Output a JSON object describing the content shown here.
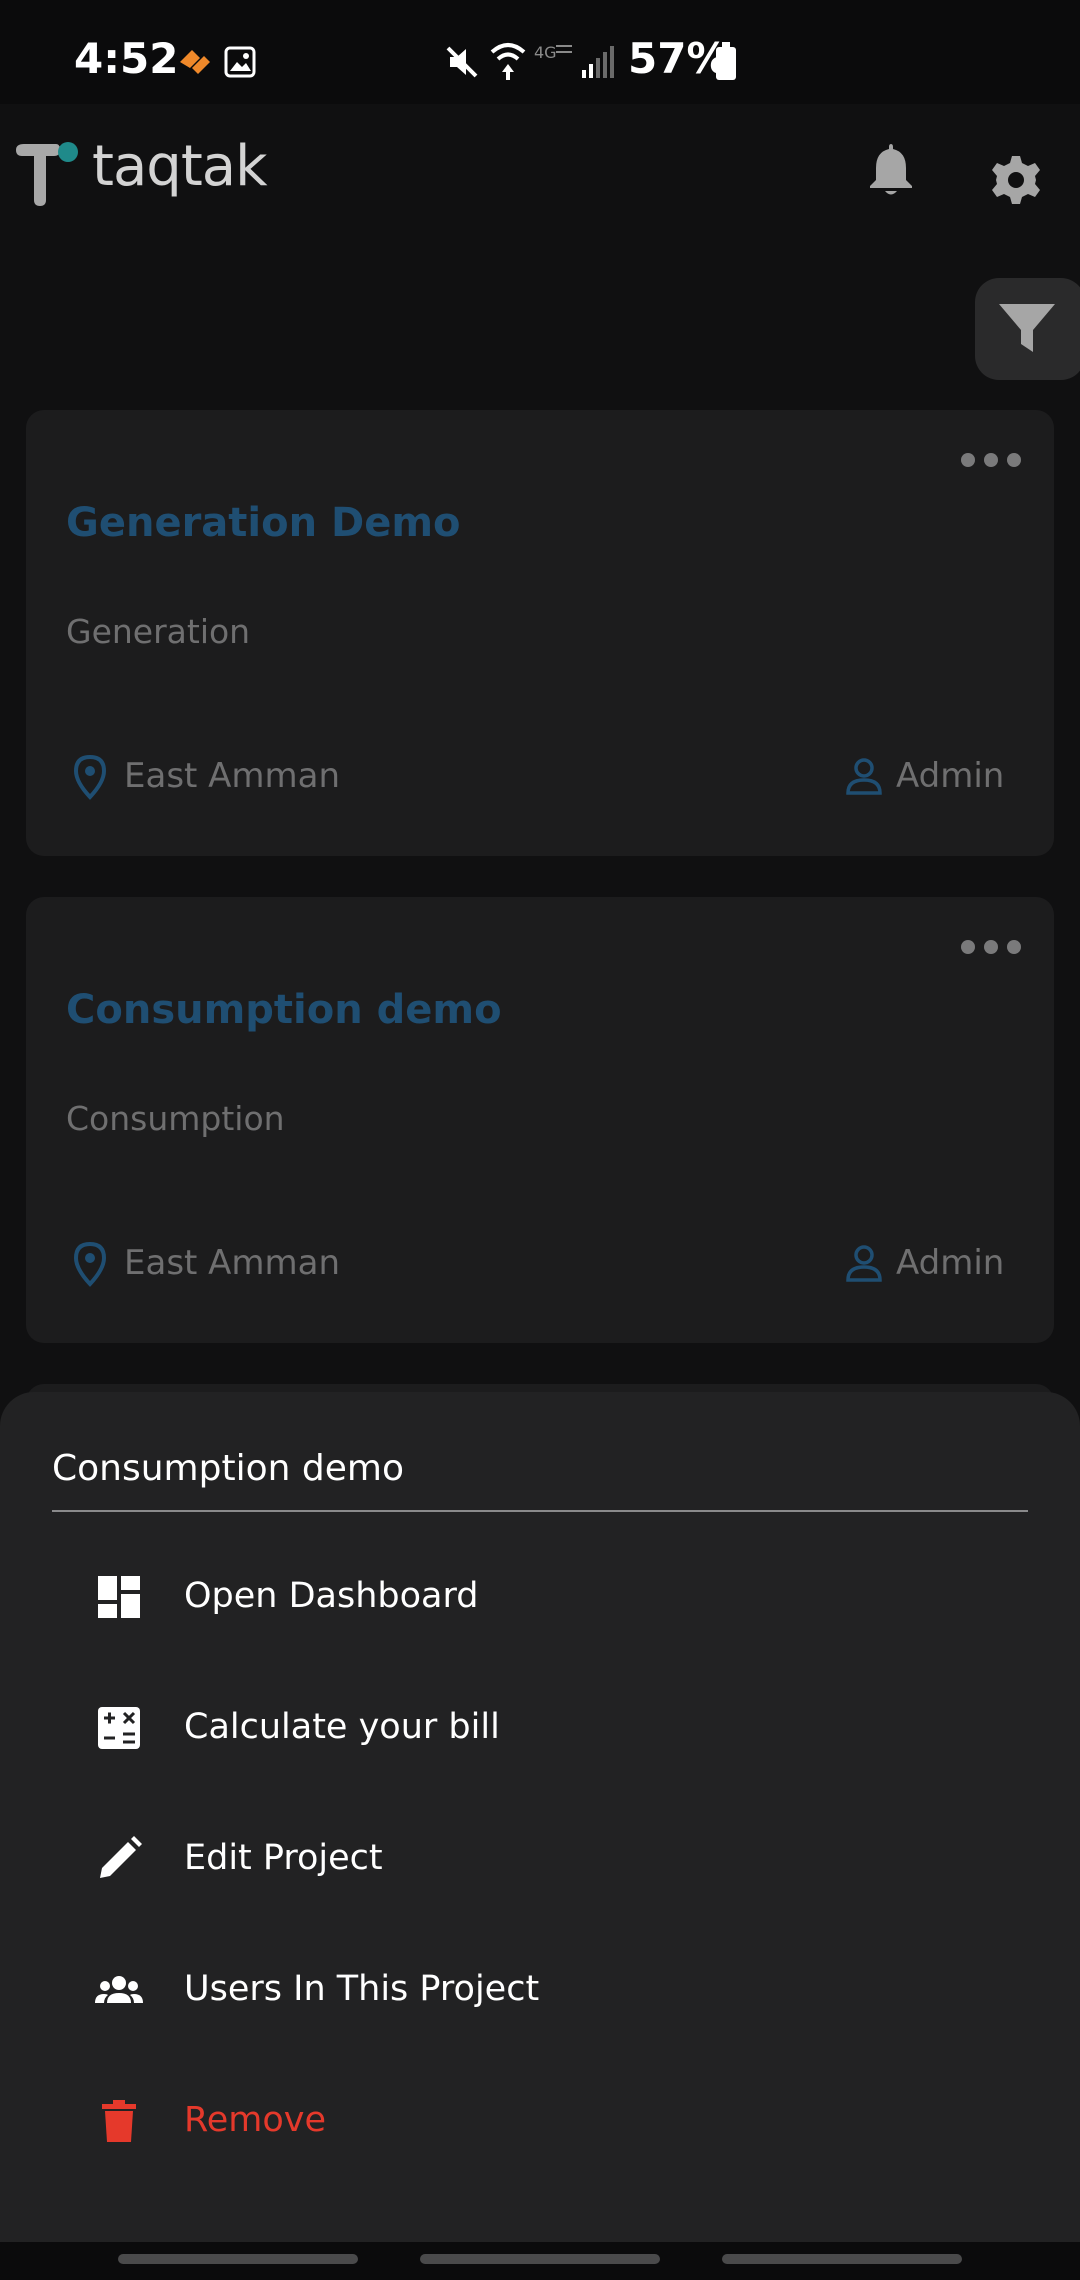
{
  "status_bar": {
    "time": "4:52",
    "battery": "57%",
    "icons": [
      "app-badge-icon",
      "gallery-icon",
      "mute-icon",
      "wifi-icon",
      "lte-icon",
      "signal-icon",
      "battery-icon"
    ]
  },
  "app_bar": {
    "logo_text": "taqtak",
    "icons": [
      "bell-icon",
      "gear-icon"
    ]
  },
  "filter": {
    "icon": "filter-icon"
  },
  "projects": [
    {
      "name": "Generation Demo",
      "type": "Generation",
      "location": "East Amman",
      "role": "Admin"
    },
    {
      "name": "Consumption demo",
      "type": "Consumption",
      "location": "East Amman",
      "role": "Admin"
    }
  ],
  "sheet": {
    "title": "Consumption demo",
    "items": [
      {
        "label": "Open Dashboard",
        "icon": "dashboard-icon"
      },
      {
        "label": "Calculate your bill",
        "icon": "calculator-icon"
      },
      {
        "label": "Edit Project",
        "icon": "pencil-icon"
      },
      {
        "label": "Users In This Project",
        "icon": "users-icon"
      },
      {
        "label": "Remove",
        "icon": "trash-icon"
      }
    ]
  },
  "colors": {
    "accent_blue": "#1f4e72",
    "danger_red": "#e5392b",
    "background": "#101011",
    "card": "#1c1c1d",
    "sheet": "#222223"
  }
}
